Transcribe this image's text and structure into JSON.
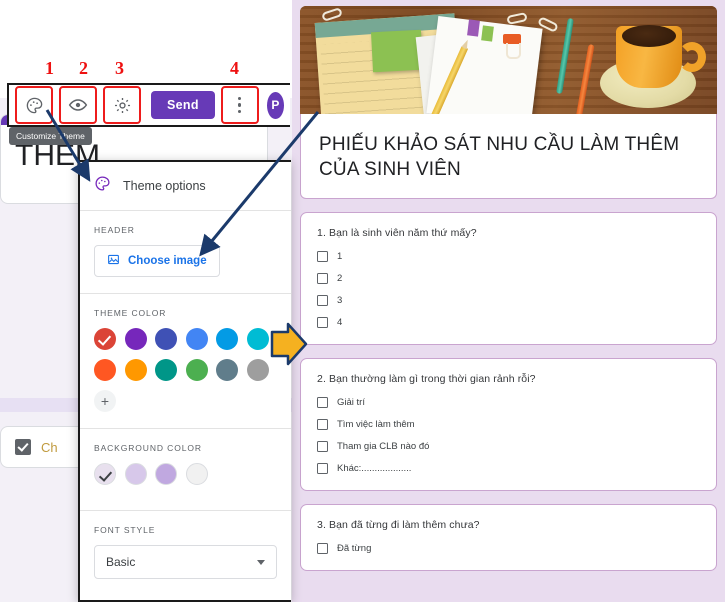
{
  "annotations": {
    "numbers": [
      "1",
      "2",
      "3",
      "4"
    ],
    "arrow_color": "#f5b120"
  },
  "toolbar": {
    "palette_icon": "palette-icon",
    "preview_icon": "eye-icon",
    "settings_icon": "gear-icon",
    "send_label": "Send",
    "more_icon": "three-dot-menu-icon",
    "avatar_initial": "P",
    "tooltip": "Customize Theme"
  },
  "editor_background": {
    "title_fragment": "THÊM",
    "option_label": "Ch",
    "accent_color": "#673ab7"
  },
  "theme_popup": {
    "title": "Theme options",
    "header": {
      "label": "HEADER",
      "choose_image_label": "Choose image",
      "image_icon": "image-icon"
    },
    "theme_color": {
      "label": "THEME COLOR",
      "row1": [
        "#db4437",
        "#7627bb",
        "#3f51b5",
        "#4285f4",
        "#039be5",
        "#00bcd4"
      ],
      "row2": [
        "#ff5722",
        "#ff9800",
        "#009688",
        "#4caf50",
        "#607d8b",
        "#9e9e9e"
      ],
      "selected_index": 1,
      "add_label": "+"
    },
    "background_color": {
      "label": "BACKGROUND COLOR",
      "swatches": [
        "#e8e0ee",
        "#d7c8ea",
        "#c0a8e0",
        "#f1f1f1"
      ],
      "selected_index": 0
    },
    "font_style": {
      "label": "FONT STYLE",
      "value": "Basic"
    }
  },
  "form_preview": {
    "banner_alt": "desk-header-image",
    "title": "PHIẾU KHẢO SÁT NHU CẦU LÀM THÊM CỦA SINH VIÊN",
    "questions": [
      {
        "text": "1. Bạn là sinh viên năm thứ mấy?",
        "options": [
          "1",
          "2",
          "3",
          "4"
        ]
      },
      {
        "text": "2. Bạn thường làm gì trong thời gian rảnh rỗi?",
        "options": [
          "Giải trí",
          "Tìm việc làm thêm",
          "Tham gia CLB nào đó",
          "Khác:..................."
        ]
      },
      {
        "text": "3. Bạn đã từng đi làm thêm chưa?",
        "options": [
          "Đã từng"
        ]
      }
    ]
  }
}
